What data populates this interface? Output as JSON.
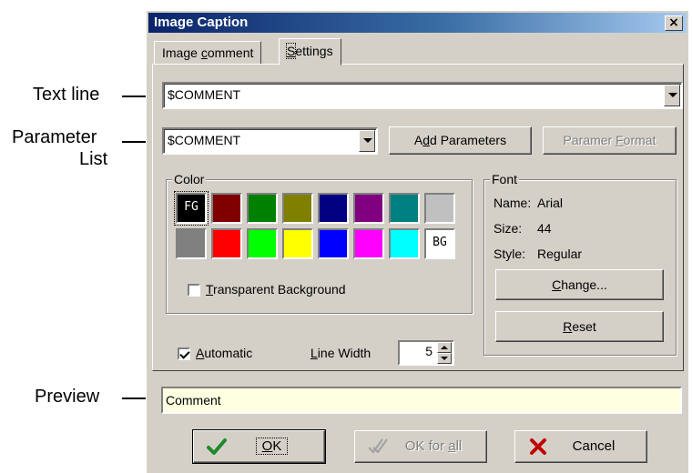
{
  "callouts": {
    "text_line": "Text line",
    "parameter_list_1": "Parameter",
    "parameter_list_2": "List",
    "preview": "Preview"
  },
  "dialog": {
    "title": "Image Caption",
    "close_glyph": "×",
    "tabs": [
      {
        "pre": "Image ",
        "u": "c",
        "post": "omment",
        "active": false
      },
      {
        "pre": "",
        "u": "S",
        "post": "ettings",
        "active": true
      }
    ]
  },
  "settings": {
    "text_line_value": "$COMMENT",
    "parameter_value": "$COMMENT",
    "add_parameters": {
      "pre": "A",
      "u": "d",
      "post": "d Parameters"
    },
    "parameter_format": {
      "pre": "Paramer ",
      "u": "F",
      "post": "ormat"
    },
    "color_group_label": "Color",
    "swatches": [
      {
        "color": "#000000",
        "label": "FG",
        "text_color": "#ffffff"
      },
      {
        "color": "#800000",
        "label": ""
      },
      {
        "color": "#008000",
        "label": ""
      },
      {
        "color": "#808000",
        "label": ""
      },
      {
        "color": "#000080",
        "label": ""
      },
      {
        "color": "#800080",
        "label": ""
      },
      {
        "color": "#008080",
        "label": ""
      },
      {
        "color": "#c0c0c0",
        "label": ""
      },
      {
        "color": "#808080",
        "label": ""
      },
      {
        "color": "#ff0000",
        "label": ""
      },
      {
        "color": "#00ff00",
        "label": ""
      },
      {
        "color": "#ffff00",
        "label": ""
      },
      {
        "color": "#0000ff",
        "label": ""
      },
      {
        "color": "#ff00ff",
        "label": ""
      },
      {
        "color": "#00ffff",
        "label": ""
      },
      {
        "color": "#ffffff",
        "label": "BG",
        "text_color": "#000000"
      }
    ],
    "transparent_background": {
      "u": "T",
      "post": "ransparent Background",
      "checked": false
    },
    "automatic": {
      "u": "A",
      "post": "utomatic",
      "checked": true
    },
    "line_width_label": {
      "u": "L",
      "post": "ine Width"
    },
    "line_width_value": "5",
    "font_group_label": "Font",
    "font_name_label": "Name:",
    "font_name": "Arial",
    "font_size_label": "Size:",
    "font_size": "44",
    "font_style_label": "Style:",
    "font_style": "Regular",
    "change_button": {
      "u": "C",
      "post": "hange..."
    },
    "reset_button": {
      "u": "R",
      "post": "eset"
    }
  },
  "preview_text": "Comment",
  "buttons": {
    "ok": {
      "u": "O",
      "post": "K"
    },
    "ok_for_all": {
      "pre": "OK for ",
      "u": "a",
      "post": "ll"
    },
    "cancel": "Cancel"
  },
  "icons": {
    "ok": "checkmark-icon",
    "ok_for_all": "double-checkmark-icon",
    "cancel": "red-x-icon"
  }
}
